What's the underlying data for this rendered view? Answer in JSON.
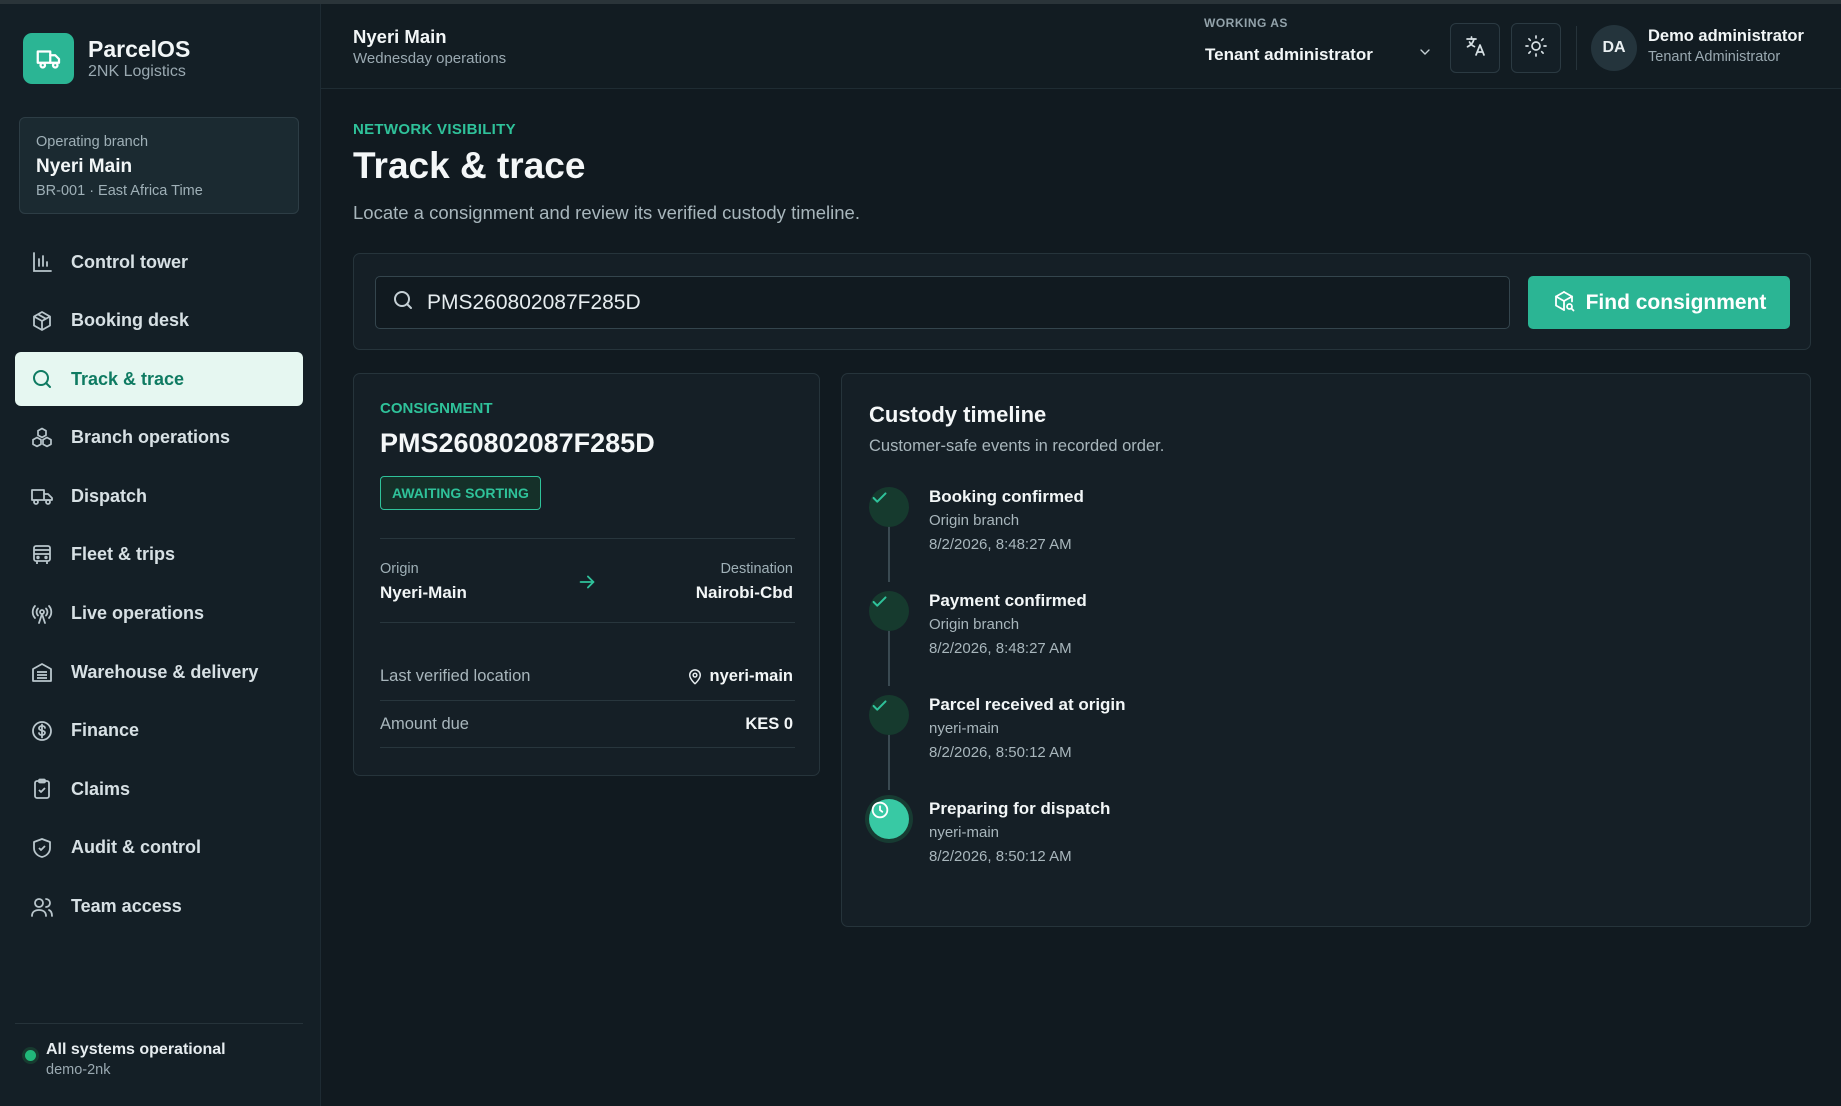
{
  "brand": {
    "name": "ParcelOS",
    "subtitle": "2NK Logistics"
  },
  "branch_card": {
    "label": "Operating branch",
    "name": "Nyeri Main",
    "meta": "BR-001 · East Africa Time"
  },
  "nav": {
    "items": [
      {
        "label": "Control tower",
        "icon": "bar-chart-icon",
        "active": false
      },
      {
        "label": "Booking desk",
        "icon": "package-icon",
        "active": false
      },
      {
        "label": "Track & trace",
        "icon": "search-icon",
        "active": true
      },
      {
        "label": "Branch operations",
        "icon": "boxes-icon",
        "active": false
      },
      {
        "label": "Dispatch",
        "icon": "truck-icon",
        "active": false
      },
      {
        "label": "Fleet & trips",
        "icon": "bus-icon",
        "active": false
      },
      {
        "label": "Live operations",
        "icon": "radio-tower-icon",
        "active": false
      },
      {
        "label": "Warehouse & delivery",
        "icon": "warehouse-icon",
        "active": false
      },
      {
        "label": "Finance",
        "icon": "dollar-circle-icon",
        "active": false
      },
      {
        "label": "Claims",
        "icon": "clipboard-check-icon",
        "active": false
      },
      {
        "label": "Audit & control",
        "icon": "shield-check-icon",
        "active": false
      },
      {
        "label": "Team access",
        "icon": "users-icon",
        "active": false
      }
    ]
  },
  "footer": {
    "status": "All systems operational",
    "tenant": "demo-2nk",
    "status_color": "#21b87a"
  },
  "header": {
    "title": "Nyeri Main",
    "subtitle": "Wednesday operations",
    "working_as_label": "WORKING AS",
    "working_as_value": "Tenant administrator",
    "user": {
      "initials": "DA",
      "name": "Demo administrator",
      "role": "Tenant Administrator"
    }
  },
  "page": {
    "eyebrow": "NETWORK VISIBILITY",
    "title": "Track & trace",
    "description": "Locate a consignment and review its verified custody timeline."
  },
  "search": {
    "value": "PMS260802087F285D",
    "button_label": "Find consignment"
  },
  "consignment": {
    "eyebrow": "CONSIGNMENT",
    "id": "PMS260802087F285D",
    "status": "AWAITING SORTING",
    "origin_label": "Origin",
    "origin": "Nyeri-Main",
    "destination_label": "Destination",
    "destination": "Nairobi-Cbd",
    "last_location_label": "Last verified location",
    "last_location": "nyeri-main",
    "amount_label": "Amount due",
    "amount": "KES 0"
  },
  "timeline": {
    "title": "Custody timeline",
    "description": "Customer-safe events in recorded order.",
    "events": [
      {
        "event": "Booking confirmed",
        "location": "Origin branch",
        "time": "8/2/2026, 8:48:27 AM",
        "state": "done"
      },
      {
        "event": "Payment confirmed",
        "location": "Origin branch",
        "time": "8/2/2026, 8:48:27 AM",
        "state": "done"
      },
      {
        "event": "Parcel received at origin",
        "location": "nyeri-main",
        "time": "8/2/2026, 8:50:12 AM",
        "state": "done"
      },
      {
        "event": "Preparing for dispatch",
        "location": "nyeri-main",
        "time": "8/2/2026, 8:50:12 AM",
        "state": "current"
      }
    ]
  },
  "colors": {
    "accent": "#2bb594",
    "background": "#111a20",
    "sidebar": "#141f26",
    "active_nav_bg": "#e6f7f1"
  }
}
